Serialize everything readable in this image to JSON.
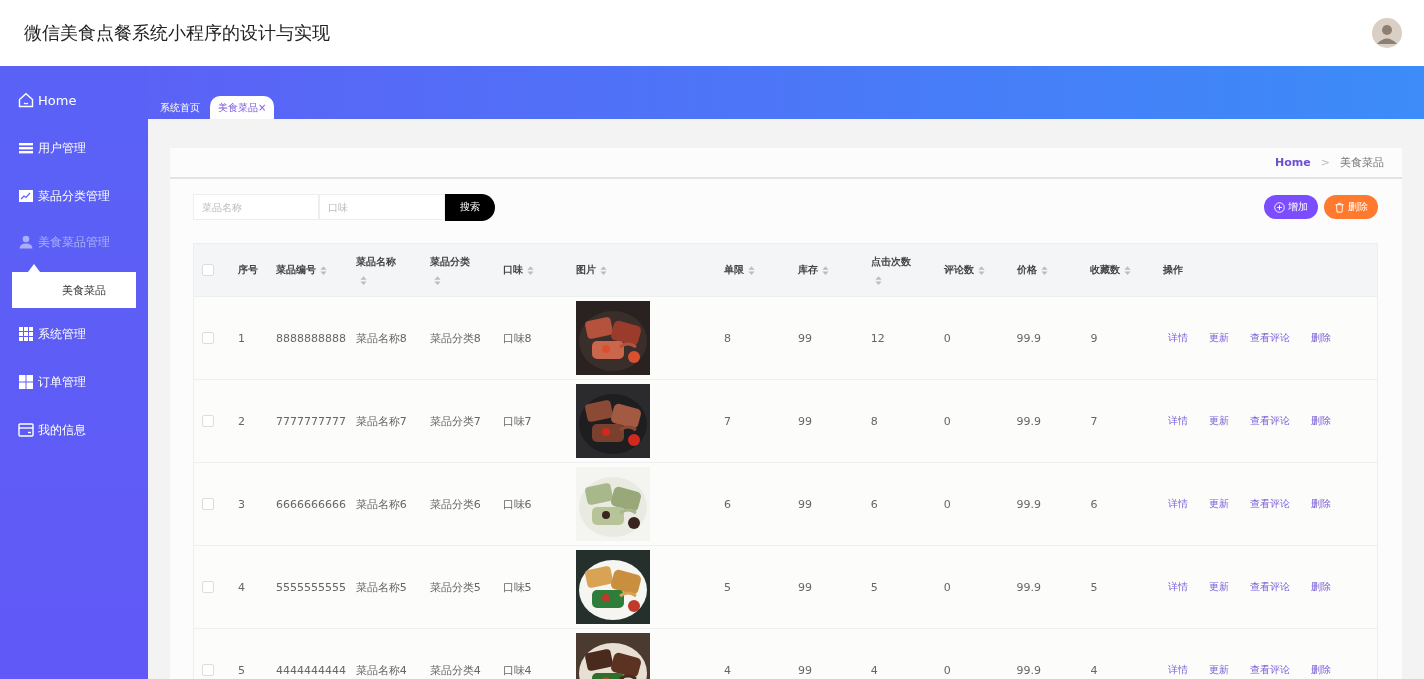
{
  "header": {
    "title": "微信美食点餐系统小程序的设计与实现"
  },
  "sidebar": {
    "items": [
      {
        "label": "Home",
        "expanded": false
      },
      {
        "label": "用户管理",
        "expanded": false
      },
      {
        "label": "菜品分类管理",
        "expanded": false
      },
      {
        "label": "美食菜品管理",
        "expanded": true,
        "children": [
          {
            "label": "美食菜品"
          }
        ]
      },
      {
        "label": "系统管理",
        "expanded": false
      },
      {
        "label": "订单管理",
        "expanded": false
      },
      {
        "label": "我的信息",
        "expanded": false
      }
    ]
  },
  "tabs": [
    {
      "label": "系统首页",
      "selected": false
    },
    {
      "label": "美食菜品",
      "selected": true,
      "close": "×"
    }
  ],
  "breadcrumb": {
    "home": "Home",
    "separator": ">",
    "current": "美食菜品"
  },
  "search": {
    "fields": [
      {
        "placeholder": "菜品名称"
      },
      {
        "placeholder": "口味"
      }
    ],
    "button": "搜索"
  },
  "buttons": [
    {
      "label": "增加",
      "kind": "add"
    },
    {
      "label": "删除",
      "kind": "delete"
    }
  ],
  "table": {
    "select_all": {
      "checked": false
    },
    "columns": [
      {
        "label": "序号",
        "sortable": false
      },
      {
        "label": "菜品编号",
        "sortable": true
      },
      {
        "label": "菜品名称",
        "sortable": true
      },
      {
        "label": "菜品分类",
        "sortable": true
      },
      {
        "label": "口味",
        "sortable": true
      },
      {
        "label": "图片",
        "sortable": true
      },
      {
        "label": "单限",
        "sortable": true
      },
      {
        "label": "库存",
        "sortable": true
      },
      {
        "label": "点击次数",
        "sortable": true
      },
      {
        "label": "评论数",
        "sortable": true
      },
      {
        "label": "价格",
        "sortable": true
      },
      {
        "label": "收藏数",
        "sortable": true
      },
      {
        "label": "操作",
        "sortable": false
      }
    ],
    "rows": [
      {
        "checked": false,
        "cells": [
          "1",
          "8888888888",
          "菜品名称8",
          "菜品分类8",
          "口味8",
          null,
          "8",
          "99",
          "12",
          "0",
          "99.9",
          "9"
        ],
        "actions": [
          "详情",
          "更新",
          "查看评论",
          "删除"
        ]
      },
      {
        "checked": false,
        "cells": [
          "2",
          "7777777777",
          "菜品名称7",
          "菜品分类7",
          "口味7",
          null,
          "7",
          "99",
          "8",
          "0",
          "99.9",
          "7"
        ],
        "actions": [
          "详情",
          "更新",
          "查看评论",
          "删除"
        ]
      },
      {
        "checked": false,
        "cells": [
          "3",
          "6666666666",
          "菜品名称6",
          "菜品分类6",
          "口味6",
          null,
          "6",
          "99",
          "6",
          "0",
          "99.9",
          "6"
        ],
        "actions": [
          "详情",
          "更新",
          "查看评论",
          "删除"
        ]
      },
      {
        "checked": false,
        "cells": [
          "4",
          "5555555555",
          "菜品名称5",
          "菜品分类5",
          "口味5",
          null,
          "5",
          "99",
          "5",
          "0",
          "99.9",
          "5"
        ],
        "actions": [
          "详情",
          "更新",
          "查看评论",
          "删除"
        ]
      },
      {
        "checked": false,
        "cells": [
          "5",
          "4444444444",
          "菜品名称4",
          "菜品分类4",
          "口味4",
          null,
          "4",
          "99",
          "4",
          "0",
          "99.9",
          "4"
        ],
        "actions": [
          "详情",
          "更新",
          "查看评论",
          "删除"
        ]
      }
    ]
  }
}
